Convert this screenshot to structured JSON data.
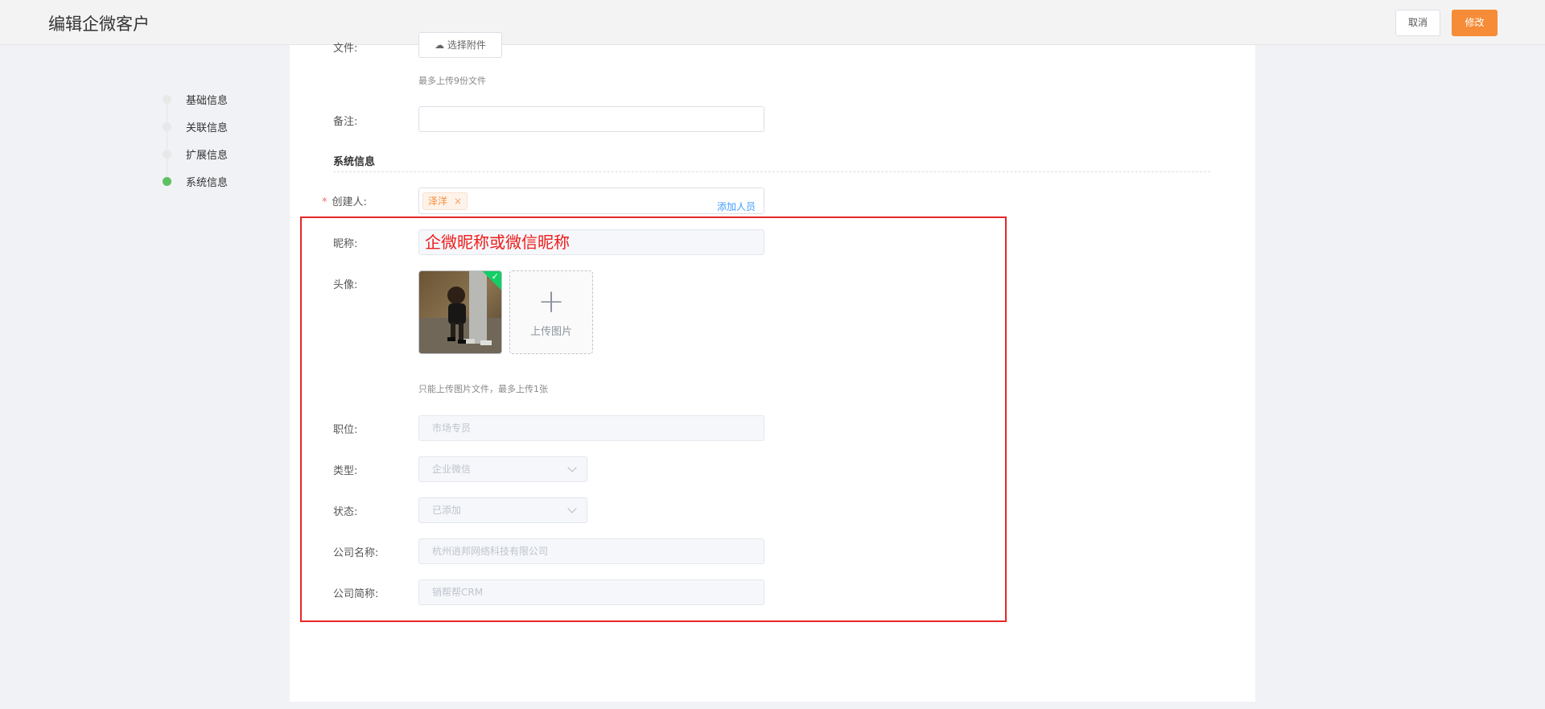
{
  "header": {
    "title": "编辑企微客户",
    "cancel": "取消",
    "save": "修改"
  },
  "steps": [
    {
      "label": "基础信息",
      "active": false
    },
    {
      "label": "关联信息",
      "active": false
    },
    {
      "label": "扩展信息",
      "active": false
    },
    {
      "label": "系统信息",
      "active": true
    }
  ],
  "form": {
    "file_label": "文件:",
    "file_button": "选择附件",
    "file_hint": "最多上传9份文件",
    "remark_label": "备注:",
    "remark_value": "",
    "system_section": "系统信息",
    "creator_label": "创建人:",
    "creator_required": "*",
    "creator_tag": "泽洋",
    "creator_tag_close": "×",
    "creator_add": "添加人员",
    "nickname_label": "昵称:",
    "nickname_value": "企微昵称或微信昵称",
    "avatar_label": "头像:",
    "avatar_check": "✓",
    "upload_plus": "+",
    "upload_text": "上传图片",
    "avatar_hint": "只能上传图片文件，最多上传1张",
    "position_label": "职位:",
    "position_value": "市场专员",
    "type_label": "类型:",
    "type_value": "企业微信",
    "status_label": "状态:",
    "status_value": "已添加",
    "company_label": "公司名称:",
    "company_value": "杭州逍邦网络科技有限公司",
    "company_short_label": "公司简称:",
    "company_short_value": "销帮帮CRM"
  },
  "colors": {
    "accent": "#f68c38",
    "active_step": "#5dc162",
    "highlight": "#e62727",
    "link": "#409eff"
  }
}
